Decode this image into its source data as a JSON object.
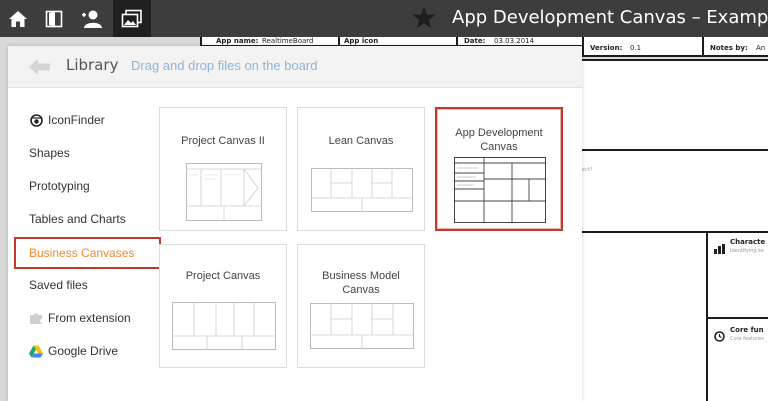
{
  "topbar": {
    "title": "App Development Canvas – Example",
    "icons": [
      "home-icon",
      "book-icon",
      "user-icon",
      "library-icon"
    ]
  },
  "board": {
    "top_cells": [
      {
        "label": "App name:",
        "value": "RealtimeBoard"
      },
      {
        "label": "App icon",
        "value": ""
      },
      {
        "label": "Date:",
        "value": "03.03.2014"
      },
      {
        "label": "Version:",
        "value": "0.1"
      },
      {
        "label": "Notes by:",
        "value": "An"
      }
    ],
    "right_headers": [
      {
        "title": "Characte",
        "sub": "Identifying ke"
      },
      {
        "title": "Core fun",
        "sub": "Core features"
      }
    ],
    "fragment": "ect?"
  },
  "library": {
    "title": "Library",
    "subtitle": "Drag and drop files on the board",
    "sidebar": [
      {
        "label": "IconFinder",
        "icon": "iconfinder-icon"
      },
      {
        "label": "Shapes",
        "icon": ""
      },
      {
        "label": "Prototyping",
        "icon": ""
      },
      {
        "label": "Tables and Charts",
        "icon": ""
      },
      {
        "label": "Business Canvases",
        "icon": "",
        "selected": true
      },
      {
        "label": "Saved files",
        "icon": ""
      },
      {
        "label": "From extension",
        "icon": "puzzle-icon"
      },
      {
        "label": "Google Drive",
        "icon": "google-drive-icon"
      }
    ],
    "cards": [
      {
        "title": "Project Canvas II"
      },
      {
        "title": "Lean Canvas"
      },
      {
        "title": "App Development Canvas",
        "highlighted": true
      },
      {
        "title": "Project Canvas"
      },
      {
        "title": "Business Model Canvas"
      }
    ]
  },
  "colors": {
    "topbar": "#3d3d3d",
    "selected_text": "#f08a2c",
    "highlight_border": "#c0392b",
    "subtitle": "#8fb5d8"
  }
}
